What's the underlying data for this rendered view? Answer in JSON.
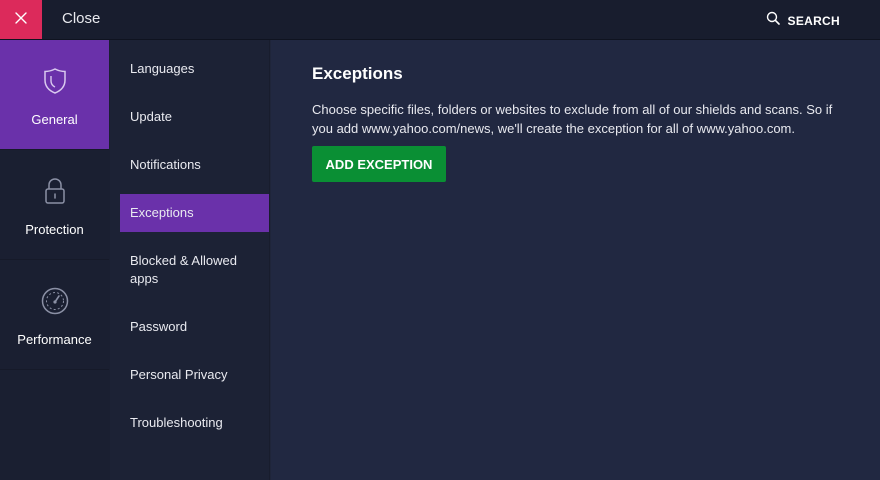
{
  "topbar": {
    "close_label": "Close",
    "search_label": "SEARCH"
  },
  "categories": [
    {
      "label": "General",
      "icon": "shield-icon"
    },
    {
      "label": "Protection",
      "icon": "lock-icon"
    },
    {
      "label": "Performance",
      "icon": "speedometer-icon"
    }
  ],
  "subnav": [
    {
      "label": "Languages"
    },
    {
      "label": "Update"
    },
    {
      "label": "Notifications"
    },
    {
      "label": "Exceptions"
    },
    {
      "label": "Blocked & Allowed apps"
    },
    {
      "label": "Password"
    },
    {
      "label": "Personal Privacy"
    },
    {
      "label": "Troubleshooting"
    }
  ],
  "main": {
    "title": "Exceptions",
    "description": "Choose specific files, folders or websites to exclude from all of our shields and scans. So if you add www.yahoo.com/news, we'll create the exception for all of www.yahoo.com.",
    "add_button": "ADD EXCEPTION"
  },
  "colors": {
    "accent": "#6a31aa",
    "close": "#dc2a5b",
    "button": "#0a8f34",
    "background": "#212841"
  }
}
